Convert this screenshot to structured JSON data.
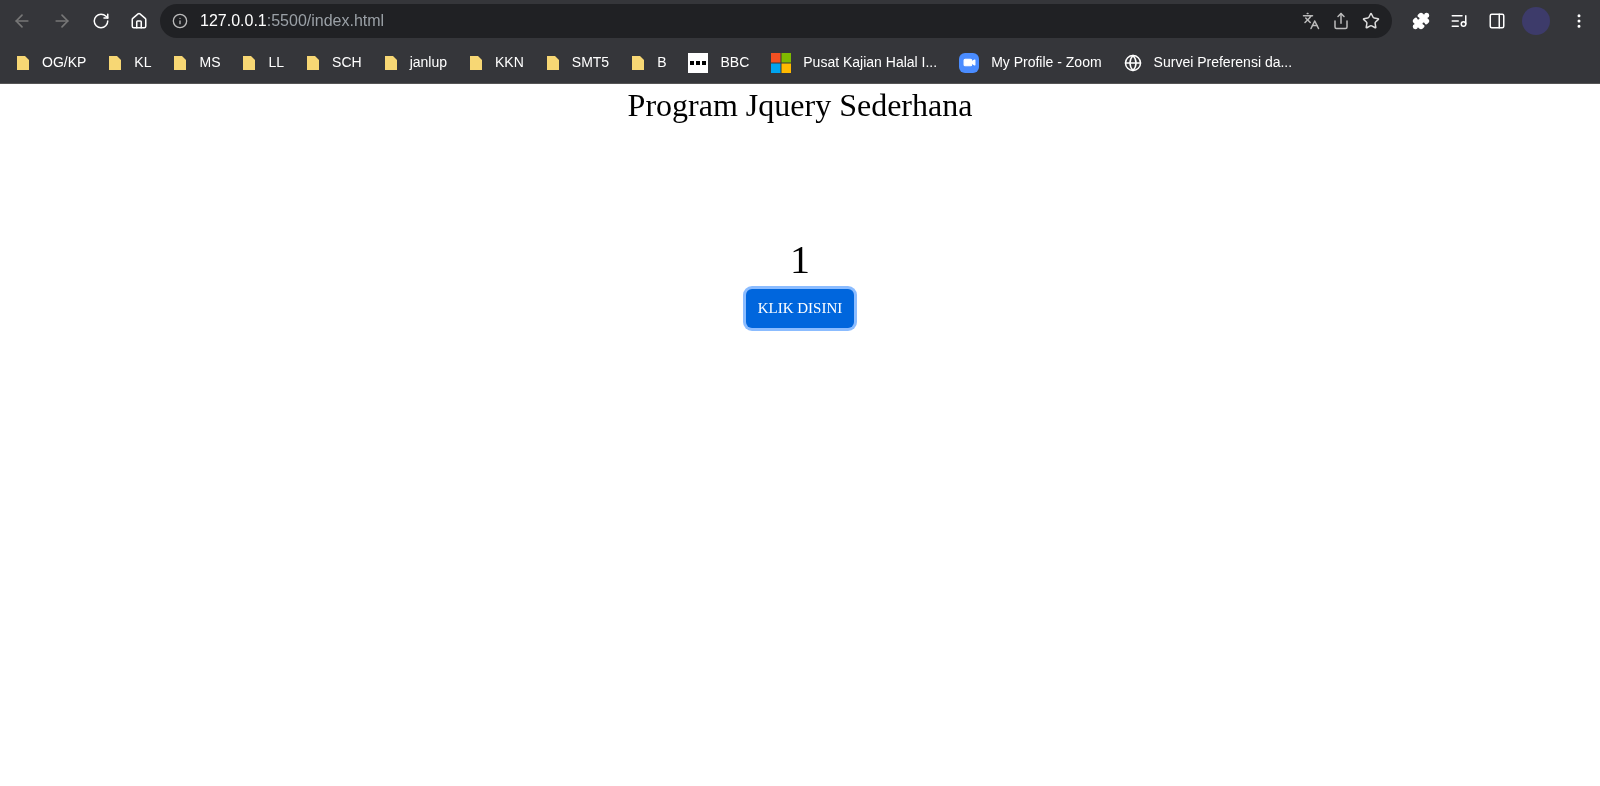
{
  "address_bar": {
    "host": "127.0.0.1",
    "path": ":5500/index.html"
  },
  "bookmarks": [
    {
      "kind": "folder",
      "label": "OG/KP"
    },
    {
      "kind": "folder",
      "label": "KL"
    },
    {
      "kind": "folder",
      "label": "MS"
    },
    {
      "kind": "folder",
      "label": "LL"
    },
    {
      "kind": "folder",
      "label": "SCH"
    },
    {
      "kind": "folder",
      "label": "janlup"
    },
    {
      "kind": "folder",
      "label": "KKN"
    },
    {
      "kind": "folder",
      "label": "SMT5"
    },
    {
      "kind": "folder",
      "label": "B"
    },
    {
      "kind": "bbc",
      "label": "BBC"
    },
    {
      "kind": "tiles",
      "label": "Pusat Kajian Halal I..."
    },
    {
      "kind": "video",
      "label": "My Profile - Zoom"
    },
    {
      "kind": "globe",
      "label": "Survei Preferensi da..."
    }
  ],
  "page": {
    "title": "Program Jquery Sederhana",
    "counter": "1",
    "button": {
      "label": "KLIK DISINI",
      "focused": true
    }
  }
}
